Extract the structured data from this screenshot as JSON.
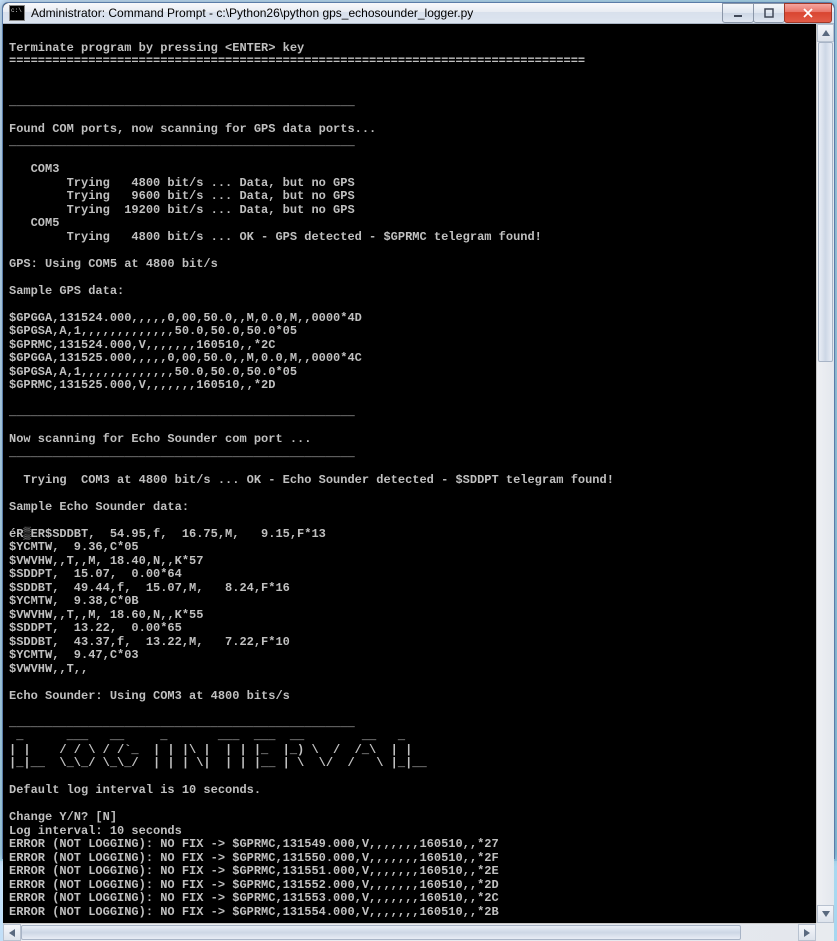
{
  "window": {
    "title": "Administrator: Command Prompt - c:\\Python26\\python  gps_echosounder_logger.py"
  },
  "console": {
    "lines": [
      "",
      "Terminate program by pressing <ENTER> key",
      "================================================================================",
      "",
      "",
      "________________________________________________",
      "",
      "Found COM ports, now scanning for GPS data ports...",
      "________________________________________________",
      "",
      "   COM3",
      "        Trying   4800 bit/s ... Data, but no GPS",
      "        Trying   9600 bit/s ... Data, but no GPS",
      "        Trying  19200 bit/s ... Data, but no GPS",
      "   COM5",
      "        Trying   4800 bit/s ... OK - GPS detected - $GPRMC telegram found!",
      "",
      "GPS: Using COM5 at 4800 bit/s",
      "",
      "Sample GPS data:",
      "",
      "$GPGGA,131524.000,,,,,0,00,50.0,,M,0.0,M,,0000*4D",
      "$GPGSA,A,1,,,,,,,,,,,,,50.0,50.0,50.0*05",
      "$GPRMC,131524.000,V,,,,,,,160510,,*2C",
      "$GPGGA,131525.000,,,,,0,00,50.0,,M,0.0,M,,0000*4C",
      "$GPGSA,A,1,,,,,,,,,,,,,50.0,50.0,50.0*05",
      "$GPRMC,131525.000,V,,,,,,,160510,,*2D",
      "",
      "________________________________________________",
      "",
      "Now scanning for Echo Sounder com port ...",
      "________________________________________________",
      "",
      "  Trying  COM3 at 4800 bit/s ... OK - Echo Sounder detected - $SDDPT telegram found!",
      "",
      "Sample Echo Sounder data:",
      "",
      "éR▒ER$SDDBT,  54.95,f,  16.75,M,   9.15,F*13",
      "$YCMTW,  9.36,C*05",
      "$VWVHW,,T,,M, 18.40,N,,K*57",
      "$SDDPT,  15.07,  0.00*64",
      "$SDDBT,  49.44,f,  15.07,M,   8.24,F*16",
      "$YCMTW,  9.38,C*0B",
      "$VWVHW,,T,,M, 18.60,N,,K*55",
      "$SDDPT,  13.22,  0.00*65",
      "$SDDBT,  43.37,f,  13.22,M,   7.22,F*10",
      "$YCMTW,  9.47,C*03",
      "$VWVHW,,T,,",
      "",
      "Echo Sounder: Using COM3 at 4800 bits/s",
      "",
      "________________________________________________",
      " _      ___   __     _       ___  ___  __        __   _",
      "| |    / / \\ / /`_  | | |\\ |  | | |_  |_) \\  /  /_\\  | |",
      "|_|__  \\_\\_/ \\_\\_/  | | | \\|  | | |__ | \\  \\/  /   \\ |_|__",
      "",
      "Default log interval is 10 seconds.",
      "",
      "Change Y/N? [N]",
      "Log interval: 10 seconds",
      "ERROR (NOT LOGGING): NO FIX -> $GPRMC,131549.000,V,,,,,,,160510,,*27",
      "ERROR (NOT LOGGING): NO FIX -> $GPRMC,131550.000,V,,,,,,,160510,,*2F",
      "ERROR (NOT LOGGING): NO FIX -> $GPRMC,131551.000,V,,,,,,,160510,,*2E",
      "ERROR (NOT LOGGING): NO FIX -> $GPRMC,131552.000,V,,,,,,,160510,,*2D",
      "ERROR (NOT LOGGING): NO FIX -> $GPRMC,131553.000,V,,,,,,,160510,,*2C",
      "ERROR (NOT LOGGING): NO FIX -> $GPRMC,131554.000,V,,,,,,,160510,,*2B"
    ]
  }
}
